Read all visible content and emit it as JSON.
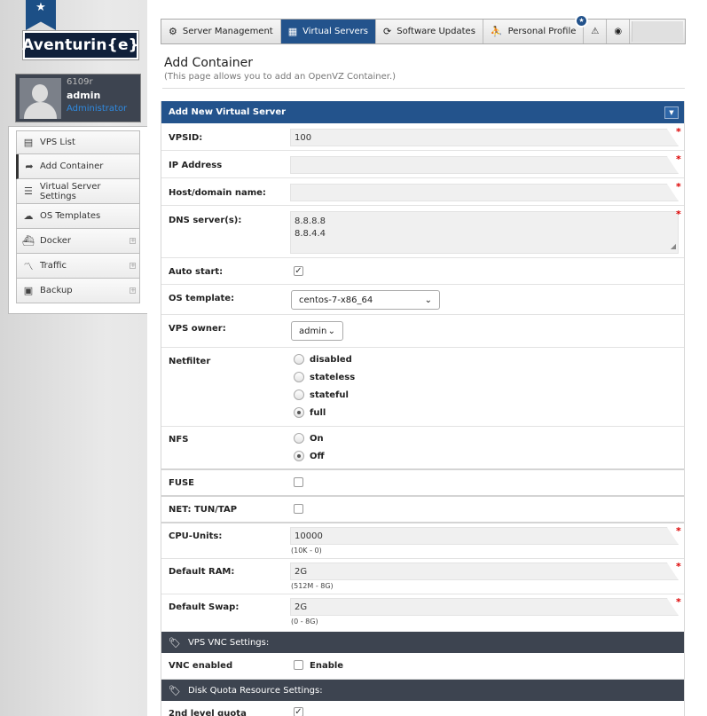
{
  "brand": {
    "logo_text": "Aventurin{e}",
    "ribbon_icon": "star-icon"
  },
  "user": {
    "id": "6109r",
    "name": "admin",
    "role": "Administrator"
  },
  "sidebar": {
    "items": [
      {
        "label": "VPS List",
        "icon": "list-icon"
      },
      {
        "label": "Add Container",
        "icon": "share-arrow-icon"
      },
      {
        "label": "Virtual Server Settings",
        "icon": "sliders-icon"
      },
      {
        "label": "OS Templates",
        "icon": "cloud-icon"
      },
      {
        "label": "Docker",
        "icon": "docker-icon"
      },
      {
        "label": "Traffic",
        "icon": "chart-icon"
      },
      {
        "label": "Backup",
        "icon": "backup-icon"
      }
    ]
  },
  "tabs": [
    {
      "label": "Server Management",
      "icon": "gear-icon"
    },
    {
      "label": "Virtual Servers",
      "icon": "grid-icon"
    },
    {
      "label": "Software Updates",
      "icon": "refresh-icon"
    },
    {
      "label": "Personal Profile",
      "icon": "person-icon"
    }
  ],
  "alerts_badge": "★",
  "page": {
    "title": "Add Container",
    "subtitle": "(This page allows you to add an OpenVZ Container.)"
  },
  "form": {
    "header": "Add New Virtual Server",
    "vpsid": {
      "label": "VPSID:",
      "value": "100"
    },
    "ip": {
      "label": "IP Address",
      "value": ""
    },
    "host": {
      "label": "Host/domain name:",
      "value": ""
    },
    "dns": {
      "label": "DNS server(s):",
      "line1": "8.8.8.8",
      "line2": "8.8.4.4"
    },
    "autostart": {
      "label": "Auto start:",
      "checked": true
    },
    "os_template": {
      "label": "OS template:",
      "value": "centos-7-x86_64"
    },
    "owner": {
      "label": "VPS owner:",
      "value": "admin"
    },
    "netfilter": {
      "label": "Netfilter",
      "options": [
        "disabled",
        "stateless",
        "stateful",
        "full"
      ],
      "selected": "full"
    },
    "nfs": {
      "label": "NFS",
      "options": [
        "On",
        "Off"
      ],
      "selected": "Off"
    },
    "fuse": {
      "label": "FUSE",
      "checked": false
    },
    "tun": {
      "label": "NET: TUN/TAP",
      "checked": false
    },
    "cpu": {
      "label": "CPU-Units:",
      "value": "10000",
      "hint": "(10K - 0)"
    },
    "ram": {
      "label": "Default RAM:",
      "value": "2G",
      "hint": "(512M - 8G)"
    },
    "swap": {
      "label": "Default Swap:",
      "value": "2G",
      "hint": "(0 - 8G)"
    },
    "vnc_section": "VPS VNC Settings:",
    "vnc": {
      "label": "VNC enabled",
      "option": "Enable",
      "checked": false
    },
    "disk_section": "Disk Quota Resource Settings:",
    "quota2": {
      "label": "2nd level quota",
      "checked": true
    },
    "required_mark": "*"
  }
}
